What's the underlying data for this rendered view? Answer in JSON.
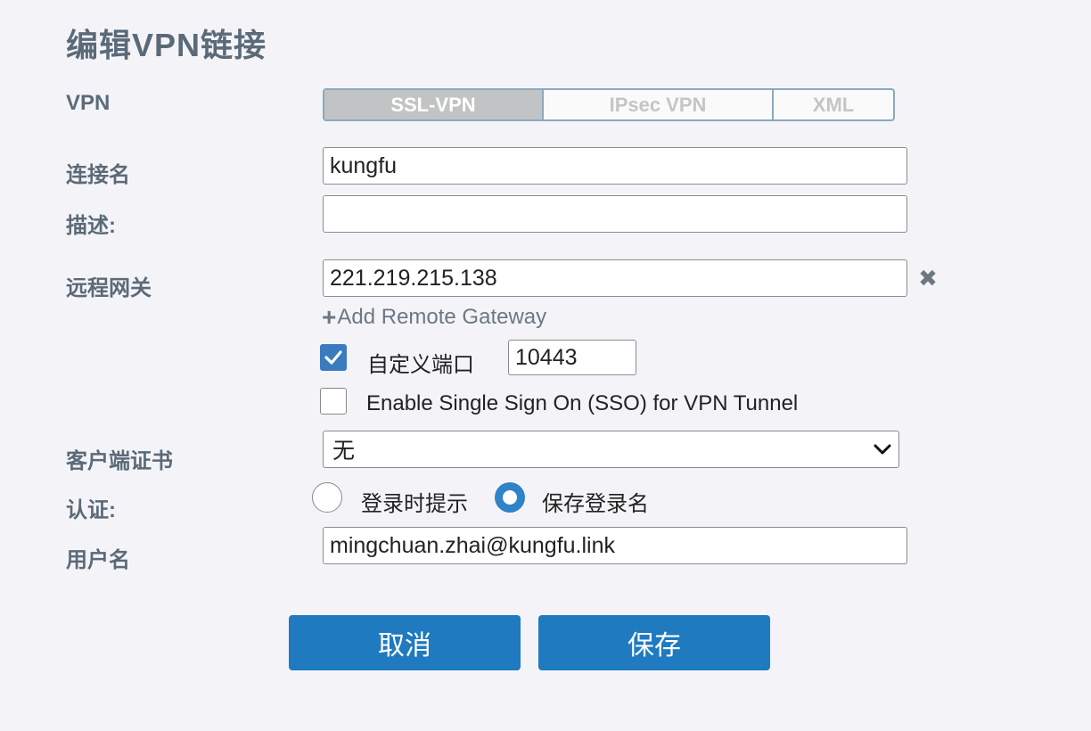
{
  "title": "编辑VPN链接",
  "vpn": {
    "label": "VPN",
    "options": [
      "SSL-VPN",
      "IPsec VPN",
      "XML"
    ],
    "selected": "SSL-VPN"
  },
  "connection_name": {
    "label": "连接名",
    "value": "kungfu"
  },
  "description": {
    "label": "描述:",
    "value": ""
  },
  "remote_gateway": {
    "label": "远程网关",
    "value": "221.219.215.138",
    "remove_icon": "close-icon",
    "add_label": "Add Remote Gateway"
  },
  "custom_port": {
    "label": "自定义端口",
    "checked": true,
    "value": "10443"
  },
  "sso": {
    "label": "Enable Single Sign On (SSO) for VPN Tunnel",
    "checked": false
  },
  "client_cert": {
    "label": "客户端证书",
    "value": "无"
  },
  "auth": {
    "label": "认证:",
    "options": [
      "登录时提示",
      "保存登录名"
    ],
    "selected": "保存登录名"
  },
  "username": {
    "label": "用户名",
    "value": "mingchuan.zhai@kungfu.link"
  },
  "buttons": {
    "cancel": "取消",
    "save": "保存"
  },
  "colors": {
    "accent": "#1f7ac0",
    "label": "#5b6a78",
    "checkbox": "#3a7bbf"
  }
}
